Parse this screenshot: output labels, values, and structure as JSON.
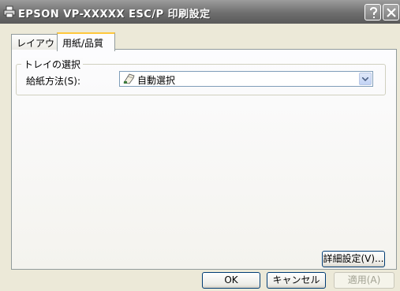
{
  "window": {
    "title": "EPSON VP-XXXXX ESC/P 印刷設定",
    "help_label": "?",
    "close_label": "×"
  },
  "tabs": [
    {
      "label": "レイアウト",
      "selected": false
    },
    {
      "label": "用紙/品質",
      "selected": true
    }
  ],
  "tray_group": {
    "title": "トレイの選択",
    "paper_source_label": "給紙方法(S):",
    "paper_source_value": "自動選択",
    "paper_source_icon": "printer-feed-icon"
  },
  "buttons": {
    "advanced": "詳細設定(V)...",
    "ok": "OK",
    "cancel": "キャンセル",
    "apply": "適用(A)"
  }
}
